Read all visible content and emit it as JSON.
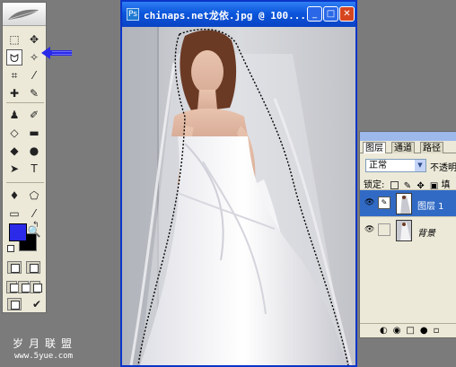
{
  "toolbox": {
    "tools": [
      {
        "icon": "marquee-icon",
        "glyph": "⬚"
      },
      {
        "icon": "move-icon",
        "glyph": "✥"
      },
      {
        "icon": "lasso-icon",
        "glyph": "ᗢ"
      },
      {
        "icon": "magic-wand-icon",
        "glyph": "✧"
      },
      {
        "icon": "crop-icon",
        "glyph": "⌗"
      },
      {
        "icon": "slice-icon",
        "glyph": "⁄"
      },
      {
        "icon": "healing-brush-icon",
        "glyph": "✚"
      },
      {
        "icon": "brush-icon",
        "glyph": "✎"
      },
      {
        "icon": "clone-stamp-icon",
        "glyph": "♟"
      },
      {
        "icon": "history-brush-icon",
        "glyph": "✐"
      },
      {
        "icon": "eraser-icon",
        "glyph": "◇"
      },
      {
        "icon": "gradient-icon",
        "glyph": "▬"
      },
      {
        "icon": "blur-icon",
        "glyph": "◆"
      },
      {
        "icon": "dodge-icon",
        "glyph": "●"
      },
      {
        "icon": "path-select-icon",
        "glyph": "➤"
      },
      {
        "icon": "type-icon",
        "glyph": "T"
      },
      {
        "icon": "pen-icon",
        "glyph": "♦"
      },
      {
        "icon": "shape-icon",
        "glyph": "⬠"
      },
      {
        "icon": "notes-icon",
        "glyph": "▭"
      },
      {
        "icon": "eyedropper-icon",
        "glyph": "⁄"
      },
      {
        "icon": "hand-icon",
        "glyph": "✋"
      },
      {
        "icon": "zoom-icon",
        "glyph": "🔍"
      }
    ],
    "selected_tool": "lasso-icon",
    "foreground_color": "#2a2ae8",
    "background_color": "#000000"
  },
  "document": {
    "title": "chinaps.net龙依.jpg @ 100...",
    "minimize": "_",
    "maximize": "□",
    "close": "✕"
  },
  "layers_panel": {
    "tabs": [
      "图层",
      "通道",
      "路径"
    ],
    "active_tab": "图层",
    "blend_mode": "正常",
    "opacity_label": "不透明",
    "lock_label": "锁定:",
    "fill_label": "填",
    "layers": [
      {
        "name": "图层 1",
        "active": true
      },
      {
        "name": "背景",
        "active": false
      }
    ],
    "bottom_icons": "◐◉□●▫"
  },
  "watermark": {
    "text": "岁月联盟",
    "url": "www.5yue.com"
  },
  "colors": {
    "window_title": "#0c56dc",
    "selection_highlight": "#316ac5",
    "workspace": "#7b7b7b"
  }
}
